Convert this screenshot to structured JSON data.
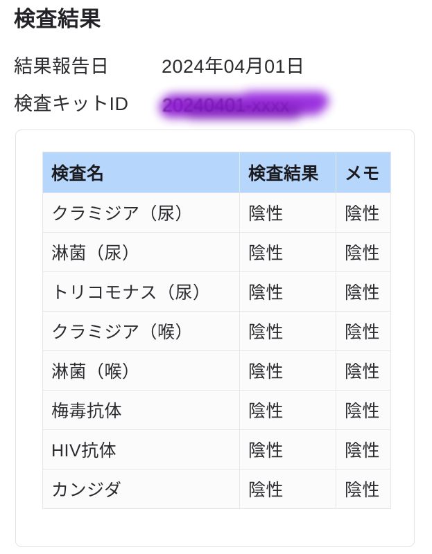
{
  "page": {
    "title": "検査結果",
    "background_color": "#ffffff"
  },
  "meta": {
    "report_date": {
      "label": "結果報告日",
      "value": "2024年04月01日"
    },
    "kit_id": {
      "label": "検査キットID",
      "value": "20240401-xxxx",
      "redacted": true,
      "redaction_color": "#8b18cf"
    }
  },
  "table": {
    "header_background": "#b6d6fb",
    "columns": [
      {
        "key": "name",
        "label": "検査名"
      },
      {
        "key": "result",
        "label": "検査結果"
      },
      {
        "key": "memo",
        "label": "メモ"
      }
    ],
    "rows": [
      {
        "name": "クラミジア（尿）",
        "result": "陰性",
        "memo": "陰性"
      },
      {
        "name": "淋菌（尿）",
        "result": "陰性",
        "memo": "陰性"
      },
      {
        "name": "トリコモナス（尿）",
        "result": "陰性",
        "memo": "陰性"
      },
      {
        "name": "クラミジア（喉）",
        "result": "陰性",
        "memo": "陰性"
      },
      {
        "name": "淋菌（喉）",
        "result": "陰性",
        "memo": "陰性"
      },
      {
        "name": "梅毒抗体",
        "result": "陰性",
        "memo": "陰性"
      },
      {
        "name": "HIV抗体",
        "result": "陰性",
        "memo": "陰性"
      },
      {
        "name": "カンジダ",
        "result": "陰性",
        "memo": "陰性"
      }
    ]
  }
}
